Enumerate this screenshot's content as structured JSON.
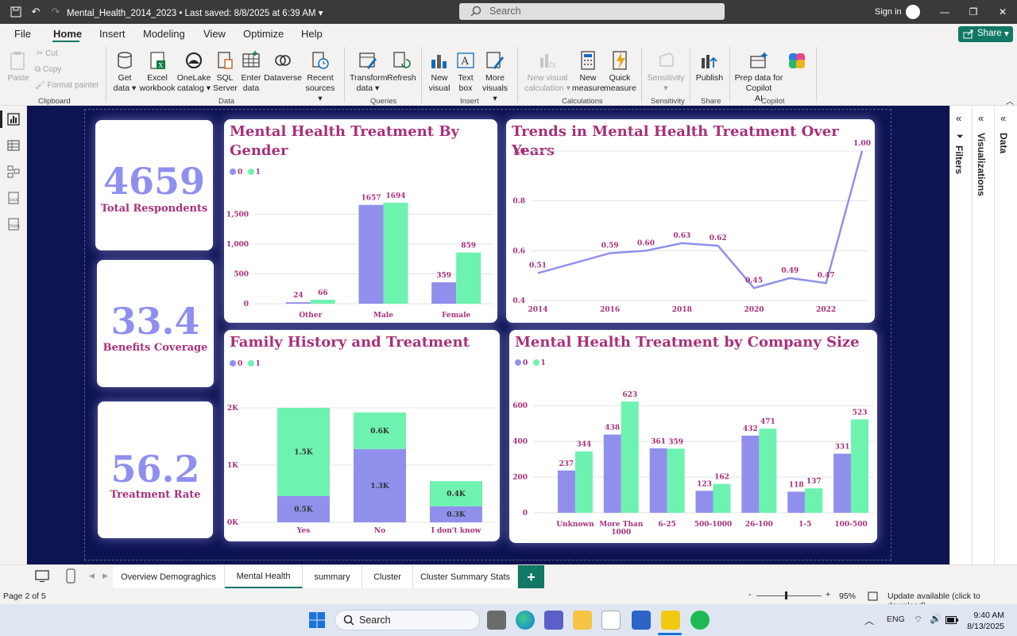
{
  "titlebar": {
    "file_name": "Mental_Health_2014_2023",
    "saved": "Last saved: 8/8/2025 at 6:39 AM",
    "search_placeholder": "Search",
    "signin": "Sign in"
  },
  "menu": {
    "tabs": [
      "File",
      "Home",
      "Insert",
      "Modeling",
      "View",
      "Optimize",
      "Help"
    ],
    "active": "Home",
    "share": "Share"
  },
  "ribbon": {
    "clipboard": {
      "paste": "Paste",
      "cut": "Cut",
      "copy": "Copy",
      "format_painter": "Format painter",
      "group": "Clipboard"
    },
    "data": {
      "get_data": [
        "Get",
        "data"
      ],
      "excel": [
        "Excel",
        "workbook"
      ],
      "onelake": [
        "OneLake",
        "catalog"
      ],
      "sql": [
        "SQL",
        "Server"
      ],
      "enter": [
        "Enter",
        "data"
      ],
      "dataverse": "Dataverse",
      "recent": [
        "Recent",
        "sources"
      ],
      "group": "Data"
    },
    "queries": {
      "transform": [
        "Transform",
        "data"
      ],
      "refresh": "Refresh",
      "group": "Queries"
    },
    "insert": {
      "new_visual": [
        "New",
        "visual"
      ],
      "text_box": [
        "Text",
        "box"
      ],
      "more_visuals": [
        "More",
        "visuals"
      ],
      "group": "Insert"
    },
    "calculations": {
      "new_visual_calc": [
        "New visual",
        "calculation"
      ],
      "new_measure": [
        "New",
        "measure"
      ],
      "quick_measure": [
        "Quick",
        "measure"
      ],
      "group": "Calculations"
    },
    "sensitivity": {
      "label": "Sensitivity",
      "group": "Sensitivity"
    },
    "share": {
      "publish": "Publish",
      "group": "Share"
    },
    "copilot": {
      "prep": [
        "Prep data for Copilot",
        "AI"
      ],
      "group": "Copilot"
    }
  },
  "kpis": [
    {
      "value": "4659",
      "label": "Total Respondents"
    },
    {
      "value": "33.4",
      "label": "Benefits Coverage"
    },
    {
      "value": "56.2",
      "label": "Treatment Rate"
    }
  ],
  "colors": {
    "series0": "#9090ec",
    "series1": "#6ef2b0",
    "title": "#a8307a",
    "canvas": "#0e1352",
    "accent": "#117865"
  },
  "legend": [
    "0",
    "1"
  ],
  "chart_data": [
    {
      "type": "bar",
      "title": "Mental Health Treatment By Gender",
      "categories": [
        "Other",
        "Male",
        "Female"
      ],
      "series": [
        {
          "name": "0",
          "values": [
            24,
            1657,
            359
          ]
        },
        {
          "name": "1",
          "values": [
            66,
            1694,
            859
          ]
        }
      ],
      "yticks": [
        "0",
        "500",
        "1,000",
        "1,500"
      ],
      "ylim": [
        0,
        2000
      ]
    },
    {
      "type": "line",
      "title": "Trends in Mental Health Treatment Over Years",
      "x": [
        2014,
        2016,
        2017,
        2018,
        2019,
        2020,
        2021,
        2022,
        2023
      ],
      "values": [
        0.51,
        0.59,
        0.6,
        0.63,
        0.62,
        0.45,
        0.49,
        0.47,
        1.0
      ],
      "labels": [
        "0.51",
        "0.59",
        "0.60",
        "0.63",
        "0.62",
        "0.45",
        "0.49",
        "0.47",
        "1.00"
      ],
      "xticks": [
        "2014",
        "2016",
        "2018",
        "2020",
        "2022"
      ],
      "yticks": [
        "0.4",
        "0.6",
        "0.8",
        "1.0"
      ],
      "ylim": [
        0.4,
        1.0
      ]
    },
    {
      "type": "bar",
      "title": "Family History and Treatment",
      "stacked": true,
      "categories": [
        "Yes",
        "No",
        "I don't know"
      ],
      "series": [
        {
          "name": "0",
          "values": [
            460,
            1280,
            280
          ],
          "labels": [
            "0.5K",
            "1.3K",
            "0.3K"
          ]
        },
        {
          "name": "1",
          "values": [
            1540,
            640,
            440
          ],
          "labels": [
            "1.5K",
            "0.6K",
            "0.4K"
          ]
        }
      ],
      "yticks": [
        "0K",
        "1K",
        "2K"
      ],
      "ylim": [
        0,
        2000
      ]
    },
    {
      "type": "bar",
      "title": "Mental Health Treatment by Company Size",
      "categories": [
        "Unknown",
        "More Than 1000",
        "6-25",
        "500-1000",
        "26-100",
        "1-5",
        "100-500"
      ],
      "series": [
        {
          "name": "0",
          "values": [
            237,
            438,
            361,
            123,
            432,
            118,
            331
          ]
        },
        {
          "name": "1",
          "values": [
            344,
            623,
            359,
            162,
            471,
            137,
            523
          ]
        }
      ],
      "yticks": [
        "0",
        "200",
        "400",
        "600"
      ],
      "ylim": [
        0,
        650
      ]
    }
  ],
  "panes": [
    "Filters",
    "Visualizations",
    "Data"
  ],
  "pages": [
    "Overview Demograghics",
    "Mental Health",
    "summary",
    "Cluster",
    "Cluster Summary Stats"
  ],
  "active_page": "Mental Health",
  "status": {
    "page": "Page 2 of 5",
    "zoom": "95%",
    "update": "Update available (click to download)"
  },
  "taskbar": {
    "search": "Search",
    "lang": "ENG",
    "time": "9:40 AM",
    "date": "8/13/2025"
  }
}
